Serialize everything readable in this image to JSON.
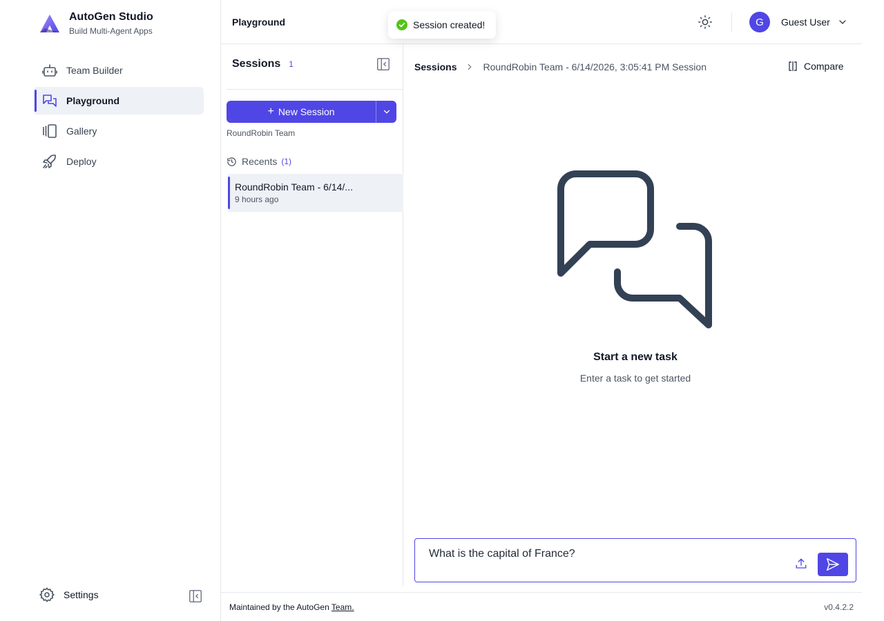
{
  "brand": {
    "title": "AutoGen Studio",
    "subtitle": "Build Multi-Agent Apps"
  },
  "nav": {
    "items": [
      {
        "label": "Team Builder",
        "icon": "bot-icon"
      },
      {
        "label": "Playground",
        "icon": "chat-icon",
        "active": true
      },
      {
        "label": "Gallery",
        "icon": "gallery-icon"
      },
      {
        "label": "Deploy",
        "icon": "rocket-icon"
      }
    ],
    "settings_label": "Settings"
  },
  "header": {
    "title": "Playground",
    "user": {
      "initial": "G",
      "name": "Guest User"
    }
  },
  "toast": {
    "message": "Session created!",
    "status_color": "#52c41a"
  },
  "sessions": {
    "title": "Sessions",
    "count": "1",
    "new_session_label": "New Session",
    "team_label": "RoundRobin Team",
    "recents_label": "Recents",
    "recents_count": "(1)",
    "items": [
      {
        "name": "RoundRobin Team - 6/14/...",
        "time": "9 hours ago"
      }
    ]
  },
  "main": {
    "breadcrumb_root": "Sessions",
    "breadcrumb_current": "RoundRobin Team - 6/14/2026, 3:05:41 PM Session",
    "compare_label": "Compare",
    "empty_title": "Start a new task",
    "empty_subtitle": "Enter a task to get started",
    "input_value": "What is the capital of France?"
  },
  "footer": {
    "maintained_prefix": "Maintained by the AutoGen",
    "maintained_link": "Team.",
    "version": "v0.4.2.2"
  },
  "colors": {
    "accent": "#4f46e5",
    "text": "#111827",
    "muted": "#4b5563",
    "border": "#e5e7eb"
  }
}
